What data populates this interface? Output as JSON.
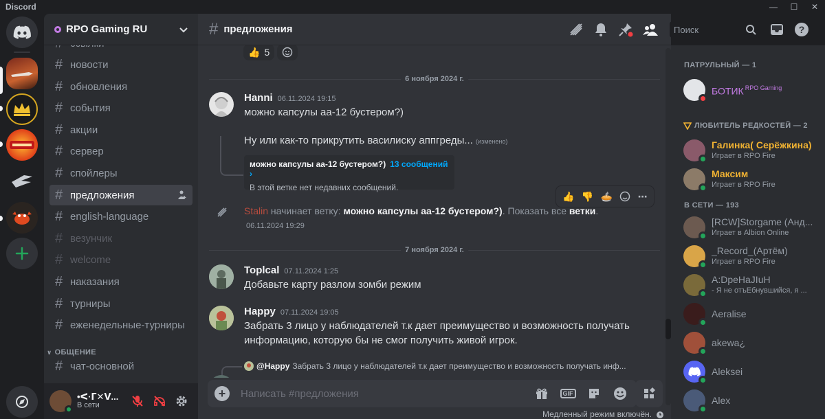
{
  "window": {
    "app_name": "Discord",
    "minimize": "—",
    "maximize": "☐",
    "close": "✕"
  },
  "server": {
    "name": "RPO Gaming RU"
  },
  "channels": [
    {
      "name": "ссылки",
      "state": "normal"
    },
    {
      "name": "новости",
      "state": "normal"
    },
    {
      "name": "обновления",
      "state": "normal"
    },
    {
      "name": "события",
      "state": "normal"
    },
    {
      "name": "акции",
      "state": "normal"
    },
    {
      "name": "сервер",
      "state": "normal"
    },
    {
      "name": "спойлеры",
      "state": "normal"
    },
    {
      "name": "предложения",
      "state": "active"
    },
    {
      "name": "english-language",
      "state": "normal"
    },
    {
      "name": "везунчик",
      "state": "muted"
    },
    {
      "name": "welcome",
      "state": "muted"
    },
    {
      "name": "наказания",
      "state": "normal"
    },
    {
      "name": "турниры",
      "state": "normal"
    },
    {
      "name": "еженедельные-турниры",
      "state": "normal"
    }
  ],
  "category_general": "ОБЩЕНИЕ",
  "channels_general": [
    {
      "name": "чат-основной"
    }
  ],
  "user": {
    "name": "•ᐸ·ᒥ✕ᐯ...",
    "status": "В сети"
  },
  "header": {
    "channel": "предложения",
    "search_placeholder": "Поиск"
  },
  "prev_reactions": [
    {
      "emoji": "👍",
      "count": "5"
    }
  ],
  "dividers": {
    "first": "6 ноября 2024 г.",
    "second": "7 ноября 2024 г."
  },
  "messages": {
    "hanni": {
      "author": "Hanni",
      "timestamp": "06.11.2024 19:15",
      "line1": "можно капсулы аа-12 бустером?)",
      "line2": "Ну или как-то прикрутить василиску аппгреды...",
      "edited": "(изменено)",
      "thread_name": "можно капсулы аа-12 бустером?)",
      "thread_count": "13 сообщений ›",
      "thread_empty": "В этой ветке нет недавних сообщений."
    },
    "system": {
      "user": "Stalin",
      "pre": " начинает ветку: ",
      "thread": "можно капсулы аа-12 бустером?)",
      "mid": ". Показать все ",
      "link": "ветки",
      "end": ".",
      "timestamp": "06.11.2024 19:29"
    },
    "topical": {
      "author": "Toplcal",
      "timestamp": "07.11.2024 1:25",
      "text": "Добавьте карту разлом зомби режим"
    },
    "happy": {
      "author": "Happy",
      "timestamp": "07.11.2024 19:05",
      "line1": "Забрать 3 лицо у наблюдателей т.к дает преимущество и возможность получать",
      "line2": "информацию, которую бы не смог получить живой игрок."
    },
    "reply": {
      "name": "@Happy",
      "text": "Забрать 3 лицо у наблюдателей т.к дает преимущество и возможность получать инф..."
    }
  },
  "composer": {
    "placeholder": "Написать #предложения",
    "gif": "GIF"
  },
  "slowmode": "Медленный режим включён.",
  "members": {
    "groups": [
      {
        "title": "ПАТРУЛЬНЫЙ — 1"
      },
      {
        "title": "ЛЮБИТЕЛЬ РЕДКОСТЕЙ — 2"
      },
      {
        "title": "В СЕТИ — 193"
      }
    ],
    "patrol": [
      {
        "name": "БОТИК",
        "tag": "RPO Gaming",
        "color": "#c27be3"
      }
    ],
    "rare": [
      {
        "name": "Галинка( Серёжкина)",
        "activity": "Играет в RPO Fire",
        "color": "#f0b232"
      },
      {
        "name": "Максим",
        "activity": "Играет в RPO Fire",
        "color": "#f0b232"
      }
    ],
    "online": [
      {
        "name": "[RCW]Storgame (Анд...",
        "activity": "Играет в Albion Online"
      },
      {
        "name": "_Record_(Артём)",
        "activity": "Играет в RPO Fire"
      },
      {
        "name": "A:DpeHaJIuH",
        "activity": "- Я не отъЕбнувшийся, я ..."
      },
      {
        "name": "Aeralise",
        "activity": ""
      },
      {
        "name": "akewa¿",
        "activity": ""
      },
      {
        "name": "Aleksei",
        "activity": ""
      },
      {
        "name": "Alex",
        "activity": ""
      }
    ]
  }
}
